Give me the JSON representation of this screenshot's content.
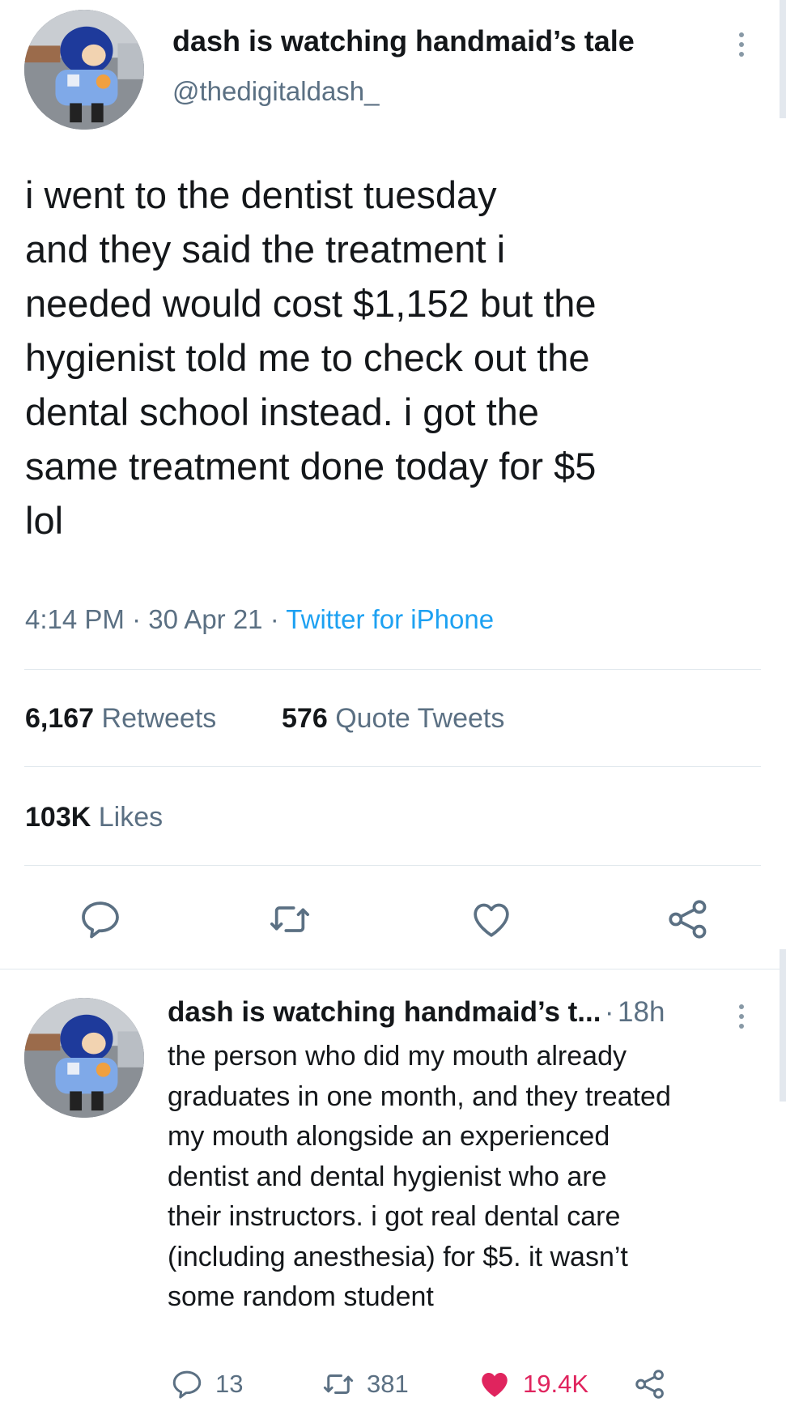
{
  "tweet": {
    "display_name": "dash is watching handmaid’s tale",
    "handle": "@thedigitaldash_",
    "text": "i went to the dentist tuesday\nand they said the treatment i\nneeded would cost $1,152 but the\nhygienist told me to check out the\ndental school instead. i got the\nsame treatment done today for $5\nlol",
    "time": "4:14 PM",
    "date": "30 Apr 21",
    "separator": "·",
    "source": "Twitter for iPhone",
    "retweets_count": "6,167",
    "retweets_label": "Retweets",
    "quotes_count": "576",
    "quotes_label": "Quote Tweets",
    "likes_count": "103K",
    "likes_label": "Likes",
    "actions": [
      "reply-icon",
      "retweet-icon",
      "like-icon",
      "share-icon"
    ]
  },
  "reply": {
    "display_name": "dash is watching handmaid’s t...",
    "separator": "·",
    "time": "18h",
    "text": "the person who did my mouth already\ngraduates in one month, and they treated\nmy mouth alongside an experienced\ndentist and dental hygienist who are\ntheir instructors. i got real dental care\n(including anesthesia) for $5. it wasn’t\nsome random student",
    "replies": "13",
    "retweets": "381",
    "likes": "19.4K",
    "liked": true
  },
  "colors": {
    "text": "#14171a",
    "secondary": "#5b7083",
    "link": "#1da1f2",
    "like_red": "#e0245e",
    "divider": "#e1e8ed"
  }
}
